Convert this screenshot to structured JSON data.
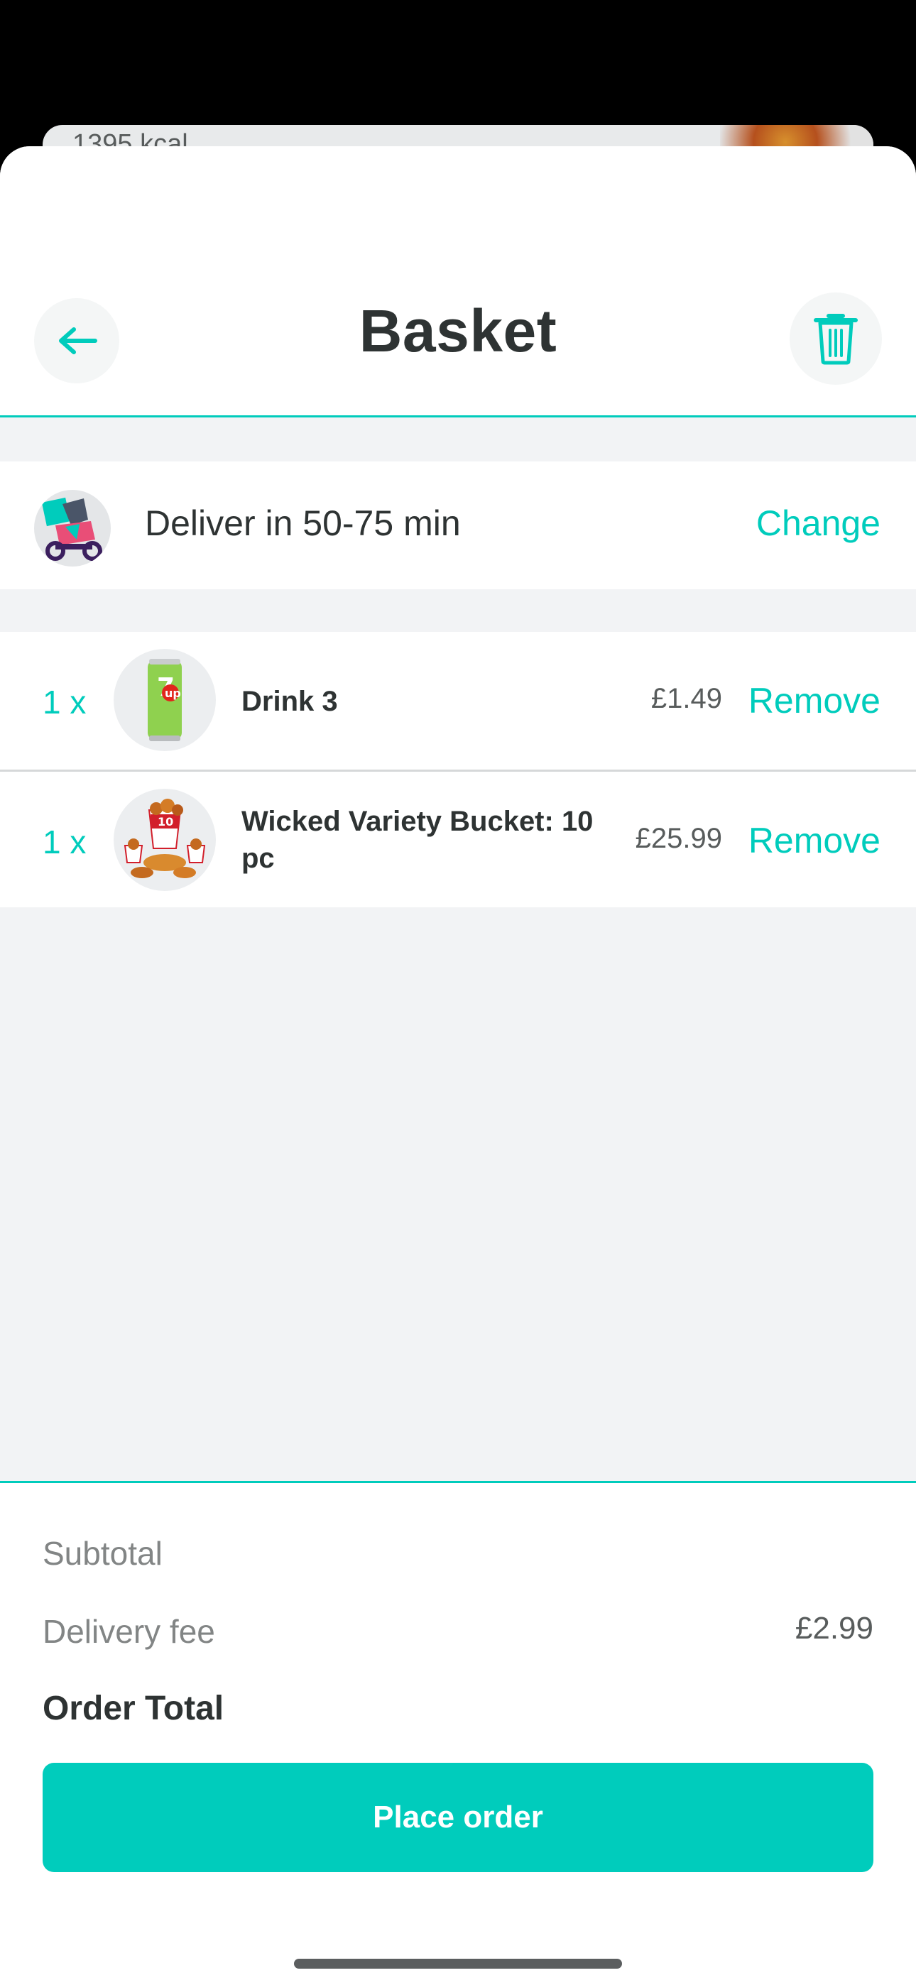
{
  "background_peek": {
    "kcal": "1395 kcal"
  },
  "header": {
    "title": "Basket"
  },
  "delivery": {
    "text": "Deliver in 50-75 min",
    "change_label": "Change"
  },
  "items": [
    {
      "qty": "1 x",
      "name": "Drink 3",
      "price": "£1.49",
      "remove_label": "Remove",
      "thumb_icon": "drink-can-icon"
    },
    {
      "qty": "1 x",
      "name": "Wicked Variety Bucket: 10 pc",
      "price": "£25.99",
      "remove_label": "Remove",
      "thumb_icon": "chicken-bucket-icon"
    }
  ],
  "summary": {
    "subtotal_label": "Subtotal",
    "delivery_fee_label": "Delivery fee",
    "delivery_fee_value": "£2.99",
    "order_total_label": "Order Total"
  },
  "actions": {
    "place_order_label": "Place order"
  },
  "colors": {
    "accent": "#00ccbc",
    "text": "#2e3333",
    "muted": "#828585",
    "background": "#f2f3f5"
  }
}
